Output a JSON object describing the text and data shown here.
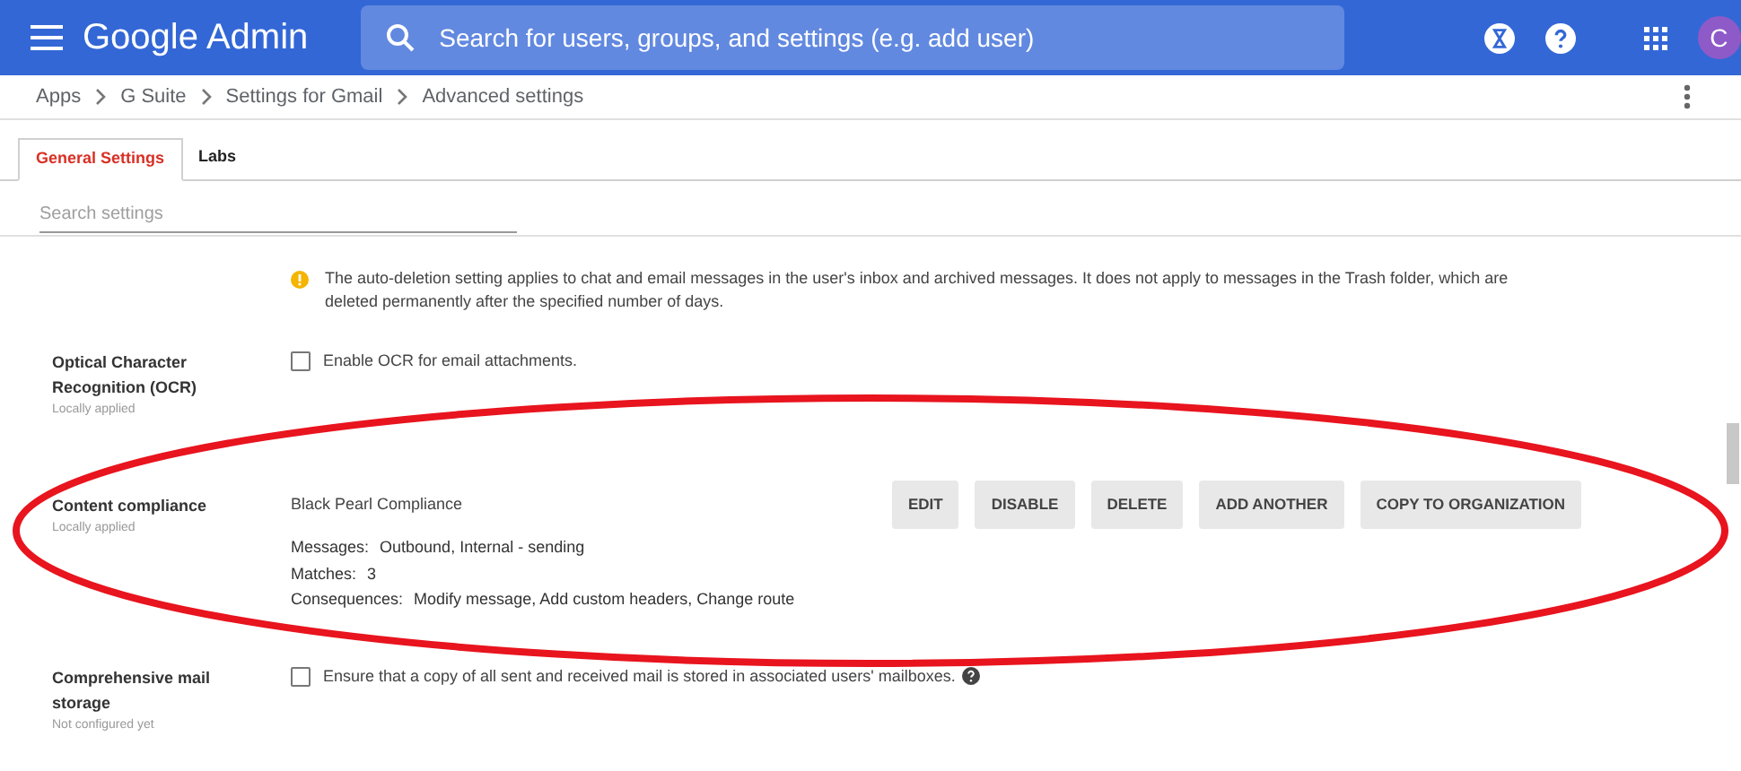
{
  "header": {
    "product": "Google Admin",
    "search_placeholder": "Search for users, groups, and settings (e.g. add user)",
    "avatar": "C"
  },
  "breadcrumb": [
    "Apps",
    "G Suite",
    "Settings for Gmail",
    "Advanced settings"
  ],
  "tabs": [
    {
      "label": "General Settings",
      "selected": true
    },
    {
      "label": "Labs",
      "selected": false
    }
  ],
  "settings_search": {
    "placeholder": "Search settings"
  },
  "info_note": "The auto-deletion setting applies to chat and email messages in the user's inbox and archived messages. It does not apply to messages in the Trash folder, which are deleted permanently after the specified number of days.",
  "settings": [
    {
      "kind": "checkbox",
      "title": "Optical Character Recognition (OCR)",
      "status": "Locally applied",
      "label": "Enable OCR for email attachments.",
      "checked": false,
      "help": false
    },
    {
      "kind": "rule",
      "title": "Content compliance",
      "status": "Locally applied",
      "rule_name": "Black Pearl Compliance",
      "details": [
        {
          "key": "Messages:",
          "value": "Outbound, Internal - sending"
        },
        {
          "key": "Matches:",
          "value": "3"
        },
        {
          "key": "Consequences:",
          "value": "Modify message, Add custom headers, Change route"
        }
      ],
      "buttons": [
        "EDIT",
        "DISABLE",
        "DELETE",
        "ADD ANOTHER",
        "COPY TO ORGANIZATION"
      ]
    },
    {
      "kind": "checkbox",
      "title": "Comprehensive mail storage",
      "status": "Not configured yet",
      "label": "Ensure that a copy of all sent and received mail is stored in associated users' mailboxes.",
      "checked": false,
      "help": true
    }
  ]
}
